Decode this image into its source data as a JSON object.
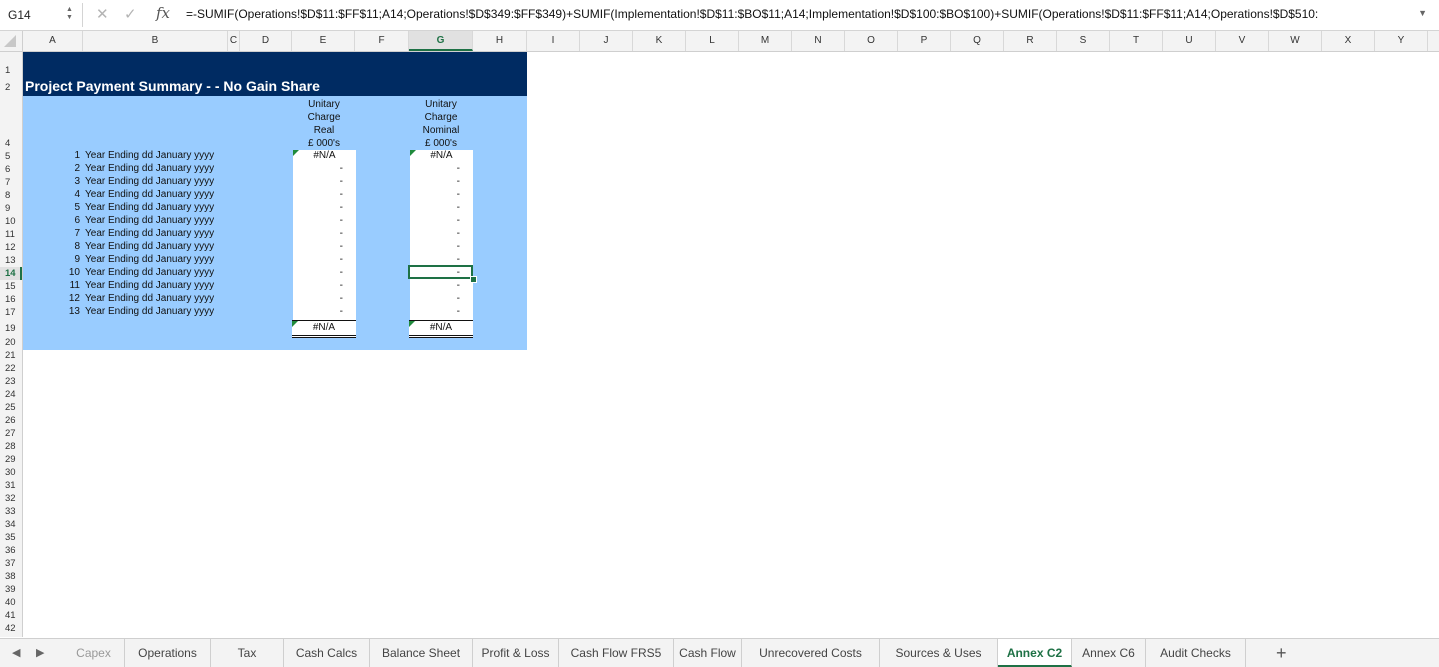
{
  "formula_bar": {
    "cell_ref": "G14",
    "formula": "=-SUMIF(Operations!$D$11:$FF$11;A14;Operations!$D$349:$FF$349)+SUMIF(Implementation!$D$11:$BO$11;A14;Implementation!$D$100:$BO$100)+SUMIF(Operations!$D$11:$FF$11;A14;Operations!$D$510:"
  },
  "columns": [
    "A",
    "B",
    "C",
    "D",
    "E",
    "F",
    "G",
    "H",
    "I",
    "J",
    "K",
    "L",
    "M",
    "N",
    "O",
    "P",
    "Q",
    "R",
    "S",
    "T",
    "U",
    "V",
    "W",
    "X",
    "Y"
  ],
  "rows_visible": [
    "1",
    "2",
    "4",
    "5",
    "6",
    "7",
    "8",
    "9",
    "10",
    "11",
    "12",
    "13",
    "14",
    "15",
    "16",
    "17",
    "19",
    "20",
    "21",
    "22",
    "23",
    "24",
    "25",
    "26",
    "27",
    "28",
    "29",
    "30",
    "31",
    "32",
    "33",
    "34",
    "35",
    "36",
    "37",
    "38",
    "39",
    "40",
    "41",
    "42"
  ],
  "sheet": {
    "title": "Project Payment Summary -  - No Gain Share",
    "col_e_header": [
      "Unitary",
      "Charge",
      "Real",
      "£ 000's"
    ],
    "col_g_header": [
      "Unitary",
      "Charge",
      "Nominal",
      "£ 000's"
    ],
    "year_rows": [
      {
        "n": "1",
        "label": "Year Ending dd January yyyy",
        "e": "#N/A",
        "g": "#N/A"
      },
      {
        "n": "2",
        "label": "Year Ending dd January yyyy",
        "e": "-",
        "g": "-"
      },
      {
        "n": "3",
        "label": "Year Ending dd January yyyy",
        "e": "-",
        "g": "-"
      },
      {
        "n": "4",
        "label": "Year Ending dd January yyyy",
        "e": "-",
        "g": "-"
      },
      {
        "n": "5",
        "label": "Year Ending dd January yyyy",
        "e": "-",
        "g": "-"
      },
      {
        "n": "6",
        "label": "Year Ending dd January yyyy",
        "e": "-",
        "g": "-"
      },
      {
        "n": "7",
        "label": "Year Ending dd January yyyy",
        "e": "-",
        "g": "-"
      },
      {
        "n": "8",
        "label": "Year Ending dd January yyyy",
        "e": "-",
        "g": "-"
      },
      {
        "n": "9",
        "label": "Year Ending dd January yyyy",
        "e": "-",
        "g": "-"
      },
      {
        "n": "10",
        "label": "Year Ending dd January yyyy",
        "e": "-",
        "g": "-"
      },
      {
        "n": "11",
        "label": "Year Ending dd January yyyy",
        "e": "-",
        "g": "-"
      },
      {
        "n": "12",
        "label": "Year Ending dd January yyyy",
        "e": "-",
        "g": "-"
      },
      {
        "n": "13",
        "label": "Year Ending dd January yyyy",
        "e": "-",
        "g": "-"
      }
    ],
    "total_e": "#N/A",
    "total_g": "#N/A"
  },
  "tabs": [
    "Capex",
    "Operations",
    "Tax",
    "Cash Calcs",
    "Balance Sheet",
    "Profit & Loss",
    "Cash Flow FRS5",
    "Cash Flow",
    "Unrecovered Costs",
    "Sources & Uses",
    "Annex C2",
    "Annex C6",
    "Audit Checks"
  ],
  "active_tab": "Annex C2",
  "selected_column": "G",
  "selected_row": "14"
}
